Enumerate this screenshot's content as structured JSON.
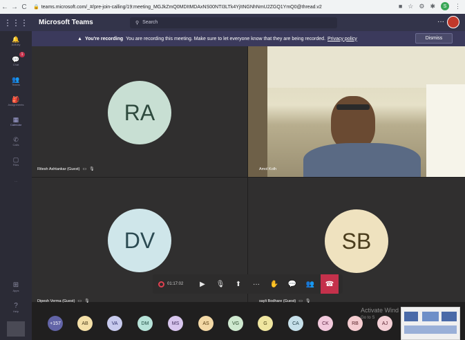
{
  "browser": {
    "url": "teams.microsoft.com/_#/pre-join-calling/19:meeting_MGJkZmQ0MDItMDAxNS00NTI3LTk4YjItNGNhNmU2ZGQ1YmQ0@thread.v2",
    "profile_initial": "S"
  },
  "teams": {
    "title": "Microsoft Teams",
    "search_placeholder": "Search",
    "more": "···"
  },
  "rail": {
    "items": [
      {
        "icon": "bell-icon",
        "label": "Activity"
      },
      {
        "icon": "chat-icon",
        "label": "Chat",
        "badge": "1"
      },
      {
        "icon": "teams-icon",
        "label": "Teams"
      },
      {
        "icon": "assignments-icon",
        "label": "Assignments"
      },
      {
        "icon": "calendar-icon",
        "label": "Calendar"
      },
      {
        "icon": "calls-icon",
        "label": "Calls"
      },
      {
        "icon": "files-icon",
        "label": "Files"
      }
    ],
    "more": "···",
    "apps_label": "Apps",
    "help_label": "Help"
  },
  "banner": {
    "title": "You're recording",
    "message": "You are recording this meeting. Make sure to let everyone know that they are being recorded.",
    "link": "Privacy policy",
    "dismiss": "Dismiss"
  },
  "tiles": [
    {
      "initials": "RA",
      "name": "Ritesh Ashtankar (Guest)",
      "bg": "#c8dfd3",
      "fg": "#2e4a3e"
    },
    {
      "initials": "",
      "name": "Amol Kolh",
      "video": true
    },
    {
      "initials": "DV",
      "name": "Dipesh Verma (Guest)",
      "bg": "#cfe6ea",
      "fg": "#2b4a52"
    },
    {
      "initials": "SB",
      "name": "sayli Bodhare (Guest)",
      "bg": "#efe2bf",
      "fg": "#4a3c1c"
    }
  ],
  "controls": {
    "timer": "01:17:02"
  },
  "participants": [
    {
      "initials": "+157",
      "bg": "#6264a7",
      "fg": "#ffffff"
    },
    {
      "initials": "AB",
      "bg": "#f5e0a8",
      "fg": "#4a3c1c"
    },
    {
      "initials": "VA",
      "bg": "#c8cbee",
      "fg": "#2b2d6a"
    },
    {
      "initials": "DM",
      "bg": "#b7e3d9",
      "fg": "#1e4a40"
    },
    {
      "initials": "MS",
      "bg": "#d8c6ee",
      "fg": "#3f2a5a"
    },
    {
      "initials": "AS",
      "bg": "#f4d9a6",
      "fg": "#5a3f12"
    },
    {
      "initials": "VG",
      "bg": "#cfe9cf",
      "fg": "#2b4a2b"
    },
    {
      "initials": "G",
      "bg": "#f0e6a0",
      "fg": "#4a4212"
    },
    {
      "initials": "CA",
      "bg": "#c6e0ea",
      "fg": "#23404a"
    },
    {
      "initials": "CK",
      "bg": "#f2c9dc",
      "fg": "#5a2240"
    },
    {
      "initials": "RB",
      "bg": "#f5ccd0",
      "fg": "#5a2228"
    },
    {
      "initials": "AJ",
      "bg": "#f4d0d6",
      "fg": "#5a2230"
    }
  ],
  "watermark": {
    "line1": "Activate Wind",
    "line2": "Go to S"
  }
}
